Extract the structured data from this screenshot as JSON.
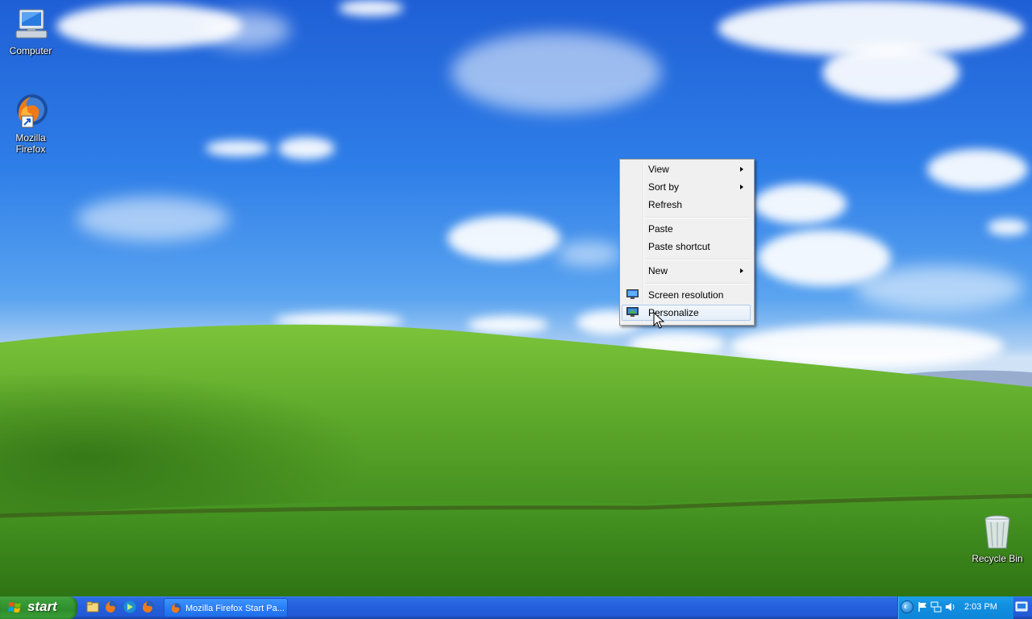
{
  "desktop": {
    "icons": [
      {
        "name": "computer",
        "label": "Computer"
      },
      {
        "name": "firefox",
        "label": "Mozilla Firefox"
      },
      {
        "name": "recycle-bin",
        "label": "Recycle Bin"
      }
    ]
  },
  "context_menu": {
    "items": [
      {
        "label": "View",
        "submenu": true
      },
      {
        "label": "Sort by",
        "submenu": true
      },
      {
        "label": "Refresh",
        "submenu": false
      },
      {
        "label": "Paste",
        "submenu": false
      },
      {
        "label": "Paste shortcut",
        "submenu": false
      },
      {
        "label": "New",
        "submenu": true
      },
      {
        "label": "Screen resolution",
        "submenu": false,
        "icon": "monitor-icon"
      },
      {
        "label": "Personalize",
        "submenu": false,
        "icon": "display-properties-icon",
        "highlighted": true
      }
    ]
  },
  "taskbar": {
    "start_label": "start",
    "quick_launch": [
      "explorer-icon",
      "firefox-icon",
      "media-player-icon",
      "firefox-icon"
    ],
    "window_button": "Mozilla Firefox Start Pa...",
    "tray": {
      "icons": [
        "action-center-flag-icon",
        "network-icon",
        "volume-icon"
      ],
      "clock": "2:03 PM"
    }
  },
  "colors": {
    "taskbar_blue": "#245edb",
    "start_green": "#3a9e38",
    "tray_blue": "#128fe0",
    "menu_bg": "#f0f0f0",
    "menu_highlight": "#e3edf9"
  }
}
